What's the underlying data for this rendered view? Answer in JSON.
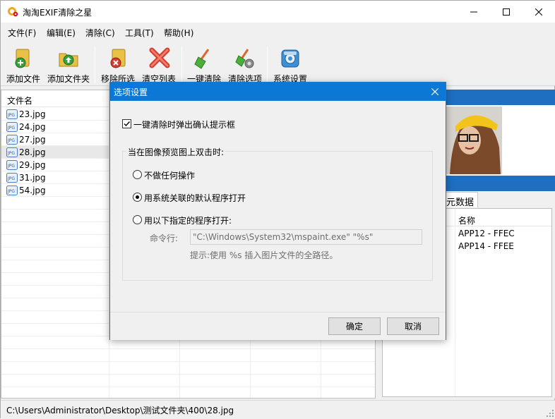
{
  "app": {
    "title": "淘淘EXIF清除之星"
  },
  "menu": [
    "文件(F)",
    "编辑(E)",
    "清除(C)",
    "工具(T)",
    "帮助(H)"
  ],
  "toolbar": {
    "add_file": "添加文件",
    "add_folder": "添加文件夹",
    "remove_selected": "移除所选",
    "clear_list": "清空列表",
    "one_click_clean": "一键清除",
    "clean_options": "清除选项",
    "settings": "系统设置"
  },
  "filelist": {
    "header": "文件名",
    "files": [
      "23.jpg",
      "24.jpg",
      "27.jpg",
      "28.jpg",
      "29.jpg",
      "31.jpg",
      "54.jpg"
    ],
    "selected_index": 3
  },
  "right_panel": {
    "tab_label": "元数据",
    "col_name": "名称",
    "rows": [
      "APP12 - FFEC",
      "APP14 - FFEE"
    ]
  },
  "status": {
    "path": "C:\\Users\\Administrator\\Desktop\\测试文件夹\\400\\28.jpg"
  },
  "dialog": {
    "title": "选项设置",
    "confirm_checkbox": "一键清除时弹出确认提示框",
    "confirm_checked": true,
    "group_title": "当在图像预览图上双击时:",
    "radio_none": "不做任何操作",
    "radio_default": "用系统关联的默认程序打开",
    "radio_custom": "用以下指定的程序打开:",
    "selected_radio": "default",
    "cmd_label": "命令行:",
    "cmd_value": "\"C:\\Windows\\System32\\mspaint.exe\" \"%s\"",
    "hint": "提示:使用 %s 插入图片文件的全路径。",
    "ok": "确定",
    "cancel": "取消"
  },
  "colors": {
    "accent": "#0b78d7",
    "panel_bar": "#1e6fc1"
  }
}
